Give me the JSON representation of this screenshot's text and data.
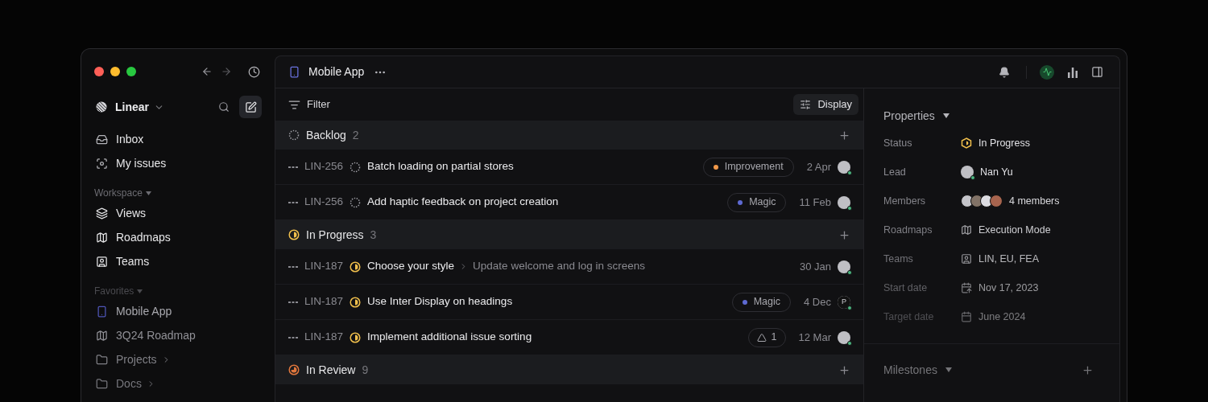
{
  "sidebar": {
    "workspace": "Linear",
    "items": [
      {
        "label": "Inbox"
      },
      {
        "label": "My issues"
      }
    ],
    "sections": [
      {
        "title": "Workspace",
        "items": [
          {
            "label": "Views"
          },
          {
            "label": "Roadmaps"
          },
          {
            "label": "Teams"
          }
        ]
      },
      {
        "title": "Favorites",
        "items": [
          {
            "label": "Mobile App"
          },
          {
            "label": "3Q24 Roadmap"
          },
          {
            "label": "Projects",
            "expandable": true
          },
          {
            "label": "Docs",
            "expandable": true
          }
        ]
      }
    ]
  },
  "header": {
    "title": "Mobile App"
  },
  "toolbar": {
    "filter": "Filter",
    "display": "Display"
  },
  "groups": [
    {
      "name": "Backlog",
      "count": "2",
      "kind": "backlog",
      "issues": [
        {
          "id": "LIN-256",
          "title": "Batch loading on partial stores",
          "label": {
            "kind": "tag",
            "text": "Improvement",
            "color": "#f2994a"
          },
          "date": "2 Apr"
        },
        {
          "id": "LIN-256",
          "title": "Add haptic feedback on project creation",
          "label": {
            "kind": "tag",
            "text": "Magic",
            "color": "#5e6ad2"
          },
          "date": "11 Feb"
        }
      ]
    },
    {
      "name": "In Progress",
      "count": "3",
      "kind": "in_progress",
      "issues": [
        {
          "id": "LIN-187",
          "title": "Choose your style",
          "subtitle": "Update welcome and log in screens",
          "date": "30 Jan"
        },
        {
          "id": "LIN-187",
          "title": "Use Inter Display on headings",
          "label": {
            "kind": "tag",
            "text": "Magic",
            "color": "#5e6ad2"
          },
          "date": "4 Dec",
          "avatar_initial": "P"
        },
        {
          "id": "LIN-187",
          "title": "Implement additional issue sorting",
          "label": {
            "kind": "count",
            "text": "1"
          },
          "date": "12 Mar"
        }
      ]
    },
    {
      "name": "In Review",
      "count": "9",
      "kind": "in_review"
    }
  ],
  "properties": {
    "title": "Properties",
    "rows": [
      {
        "label": "Status",
        "value": "In Progress"
      },
      {
        "label": "Lead",
        "value": "Nan Yu"
      },
      {
        "label": "Members",
        "value": "4 members"
      },
      {
        "label": "Roadmaps",
        "value": "Execution Mode"
      },
      {
        "label": "Teams",
        "value": "LIN, EU, FEA"
      },
      {
        "label": "Start date",
        "value": "Nov 17, 2023"
      },
      {
        "label": "Target date",
        "value": "June 2024"
      }
    ]
  },
  "milestones": {
    "title": "Milestones"
  }
}
